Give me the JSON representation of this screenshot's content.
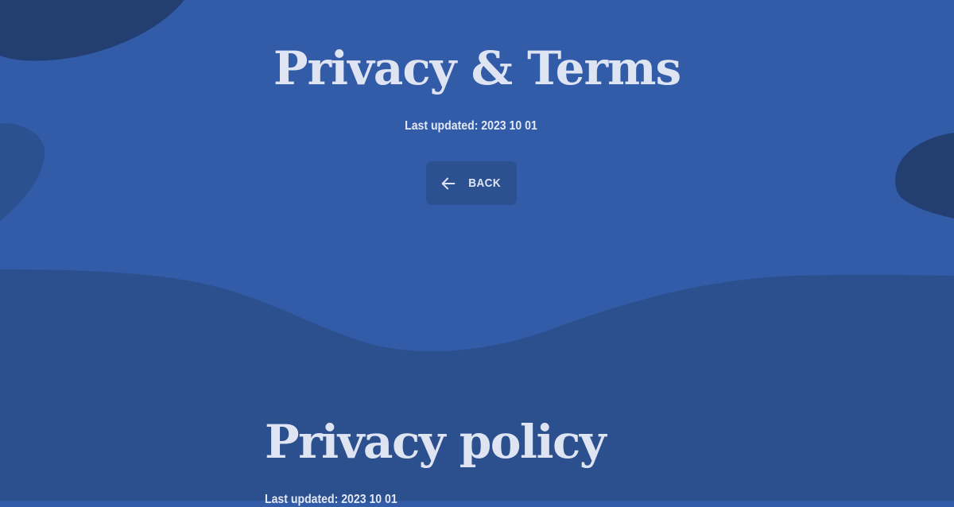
{
  "hero": {
    "title": "Privacy & Terms",
    "updated": "Last updated: 2023 10 01",
    "back_label": "BACK"
  },
  "section": {
    "title": "Privacy policy",
    "updated": "Last updated: 2023 10 01"
  },
  "icons": {
    "back": "arrow-left-icon"
  },
  "colors": {
    "background": "#335ca8",
    "lower_wave": "#2c4f8e",
    "blob_dark": "#233f72",
    "text": "#dfe4f3",
    "button": "#2c5191"
  }
}
